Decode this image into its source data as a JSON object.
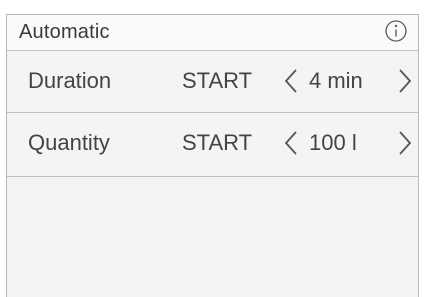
{
  "header": {
    "title": "Automatic",
    "info_icon": "info-circle-icon"
  },
  "rows": [
    {
      "label": "Duration",
      "start_label": "START",
      "value": "4 min",
      "prev_icon": "chevron-left-icon",
      "next_icon": "chevron-right-icon"
    },
    {
      "label": "Quantity",
      "start_label": "START",
      "value": "100 l",
      "prev_icon": "chevron-left-icon",
      "next_icon": "chevron-right-icon"
    }
  ],
  "colors": {
    "text": "#444444",
    "border": "#c2c2c2",
    "background": "#f3f3f3"
  }
}
